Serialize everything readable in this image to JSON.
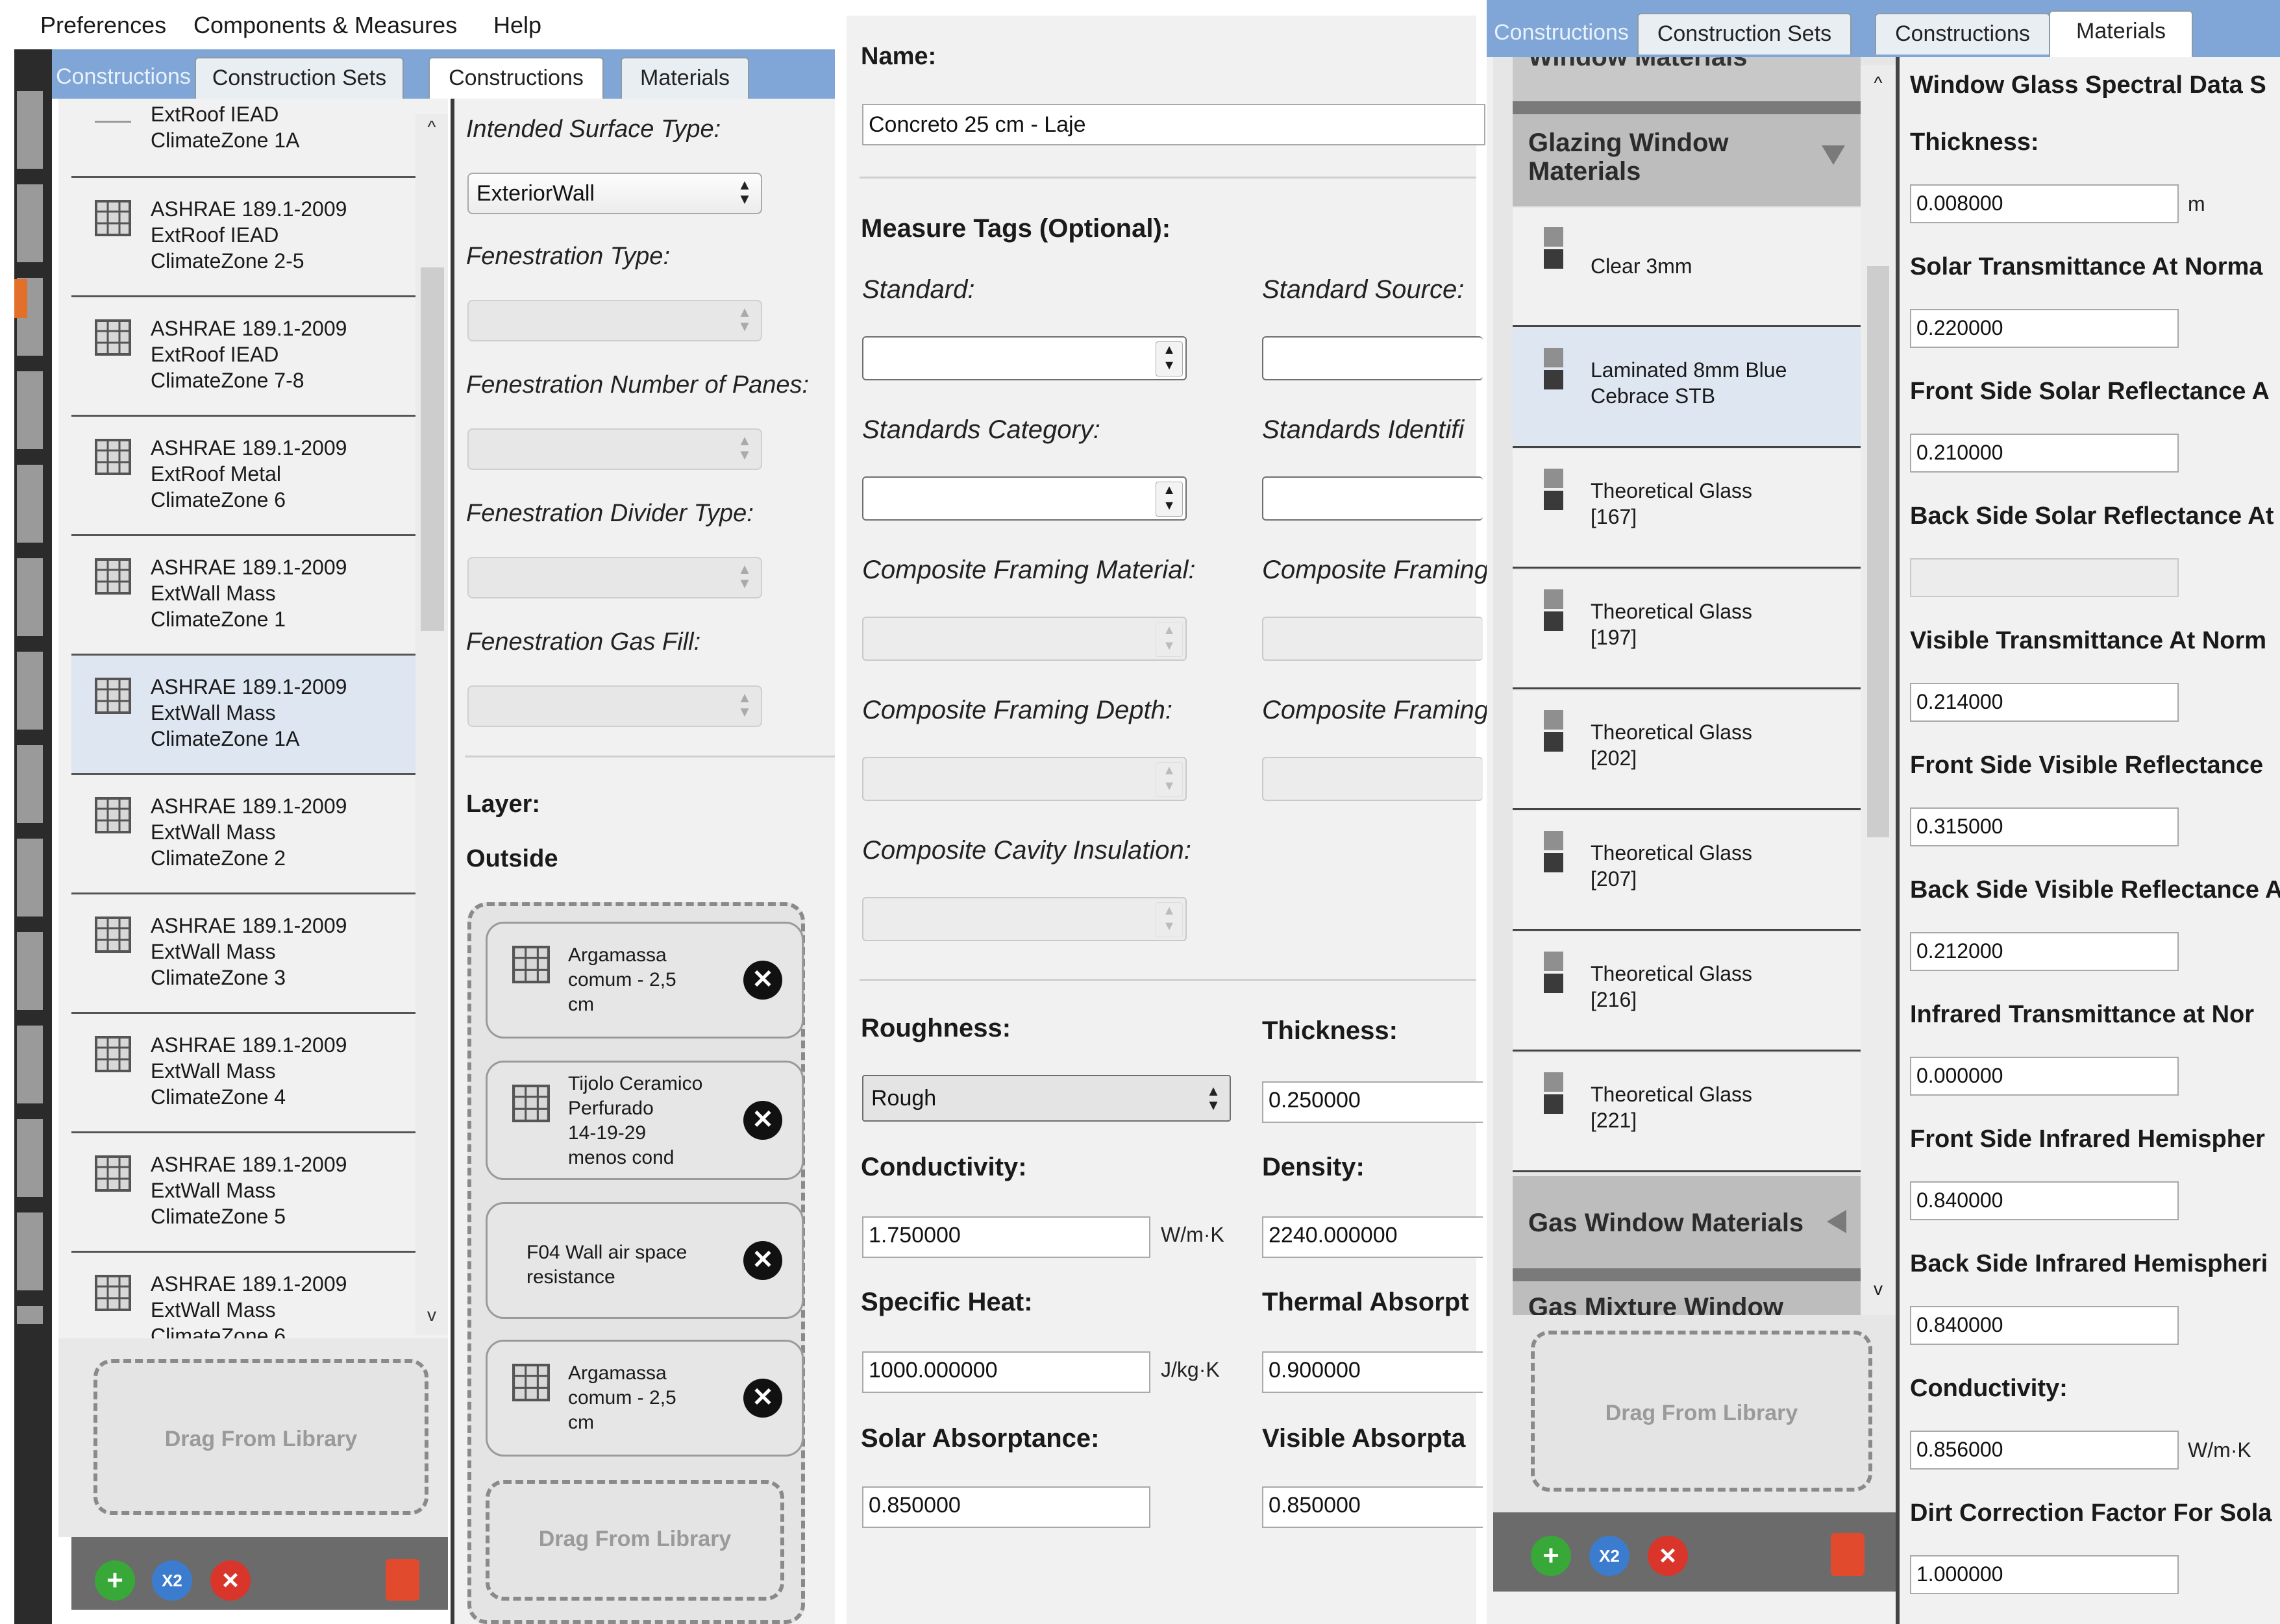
{
  "menu": {
    "preferences": "Preferences",
    "components": "Components & Measures",
    "help": "Help"
  },
  "panel1": {
    "tabs": [
      "Constructions",
      "Construction Sets",
      "Constructions",
      "Materials"
    ],
    "list_partial_top": "ExtRoof IEAD\nClimateZone 1A",
    "list": [
      "ASHRAE 189.1-2009\nExtRoof IEAD\nClimateZone 2-5",
      "ASHRAE 189.1-2009\nExtRoof IEAD\nClimateZone 7-8",
      "ASHRAE 189.1-2009\nExtRoof Metal\nClimateZone 6",
      "ASHRAE 189.1-2009\nExtWall Mass\nClimateZone 1",
      "ASHRAE 189.1-2009\nExtWall Mass\nClimateZone 1A",
      "ASHRAE 189.1-2009\nExtWall Mass\nClimateZone 2",
      "ASHRAE 189.1-2009\nExtWall Mass\nClimateZone 3",
      "ASHRAE 189.1-2009\nExtWall Mass\nClimateZone 4",
      "ASHRAE 189.1-2009\nExtWall Mass\nClimateZone 5",
      "ASHRAE 189.1-2009\nExtWall Mass\nClimateZone 6"
    ],
    "drag_from_library": "Drag From Library",
    "intended_surface_label": "Intended Surface Type:",
    "intended_surface_value": "ExteriorWall",
    "fenestration_type_label": "Fenestration Type:",
    "fenestration_panes_label": "Fenestration Number of Panes:",
    "fenestration_divider_label": "Fenestration Divider Type:",
    "fenestration_gas_label": "Fenestration Gas Fill:",
    "layer_label": "Layer:",
    "outside_label": "Outside",
    "layers": [
      "Argamassa\ncomum - 2,5\ncm",
      "Tijolo Ceramico\nPerfurado\n14-19-29\nmenos cond",
      "F04 Wall air space\nresistance",
      "Argamassa\ncomum - 2,5\ncm"
    ],
    "layer_drag": "Drag From Library",
    "x2_label": "X2"
  },
  "panel2": {
    "name_label": "Name:",
    "name_value": "Concreto 25 cm - Laje",
    "measure_tags": "Measure Tags (Optional):",
    "standard": "Standard:",
    "standard_source": "Standard Source:",
    "standards_category": "Standards Category:",
    "standards_identifier": "Standards Identifi",
    "composite_framing_material": "Composite Framing Material:",
    "composite_framing_right1": "Composite Framing",
    "composite_framing_depth": "Composite Framing Depth:",
    "composite_framing_right2": "Composite Framing",
    "composite_cavity": "Composite Cavity Insulation:",
    "roughness_label": "Roughness:",
    "roughness_value": "Rough",
    "thickness_label": "Thickness:",
    "thickness_value": "0.250000",
    "conductivity_label": "Conductivity:",
    "conductivity_value": "1.750000",
    "conductivity_unit": "W/m·K",
    "density_label": "Density:",
    "density_value": "2240.000000",
    "specific_heat_label": "Specific Heat:",
    "specific_heat_value": "1000.000000",
    "specific_heat_unit": "J/kg·K",
    "thermal_abs_label": "Thermal Absorpt",
    "thermal_abs_value": "0.900000",
    "solar_abs_label": "Solar Absorptance:",
    "solar_abs_value": "0.850000",
    "visible_abs_label": "Visible Absorpta",
    "visible_abs_value": "0.850000"
  },
  "panel3": {
    "tabs": [
      "Constructions",
      "Construction Sets",
      "Constructions",
      "Materials"
    ],
    "window_materials_partial": "Window Materials",
    "glazing_header": "Glazing Window\nMaterials",
    "glazing_items": [
      "Clear 3mm",
      "Laminated 8mm Blue\nCebrace STB",
      "Theoretical Glass\n[167]",
      "Theoretical Glass\n[197]",
      "Theoretical Glass\n[202]",
      "Theoretical Glass\n[207]",
      "Theoretical Glass\n[216]",
      "Theoretical Glass\n[221]"
    ],
    "gas_header": "Gas Window Materials",
    "gas_mixture_partial": "Gas Mixture Window",
    "drag_from_library": "Drag From Library",
    "x2_label": "X2",
    "spectral_title": "Window Glass Spectral Data S",
    "thickness_label": "Thickness:",
    "thickness_value": "0.008000",
    "thickness_unit": "m",
    "solar_trans_label": "Solar Transmittance At Norma",
    "solar_trans_value": "0.220000",
    "front_solar_refl_label": "Front Side Solar Reflectance A",
    "front_solar_refl_value": "0.210000",
    "back_solar_refl_label": "Back Side Solar Reflectance At",
    "visible_trans_label": "Visible Transmittance At Norm",
    "visible_trans_value": "0.214000",
    "front_vis_refl_label": "Front Side Visible Reflectance",
    "front_vis_refl_value": "0.315000",
    "back_vis_refl_label": "Back Side Visible Reflectance A",
    "back_vis_refl_value": "0.212000",
    "ir_trans_label": "Infrared Transmittance at Nor",
    "ir_trans_value": "0.000000",
    "front_ir_label": "Front Side Infrared Hemispher",
    "front_ir_value": "0.840000",
    "back_ir_label": "Back Side Infrared Hemispheri",
    "back_ir_value": "0.840000",
    "conductivity_label": "Conductivity:",
    "conductivity_value": "0.856000",
    "conductivity_unit": "W/m·K",
    "dirt_label": "Dirt Correction Factor For Sola",
    "dirt_value": "1.000000"
  }
}
